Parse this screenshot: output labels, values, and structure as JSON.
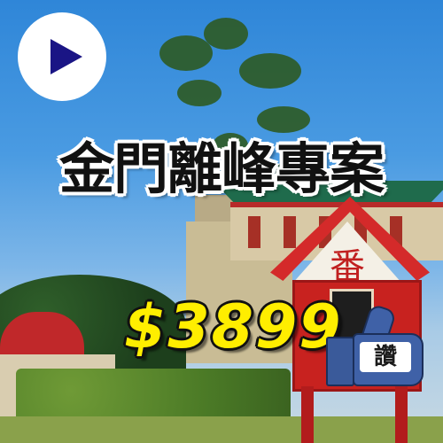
{
  "banner": {
    "title": "金門離峰專案",
    "price": "$3899",
    "like_label": "讚",
    "shrine_character": "番"
  },
  "controls": {
    "play_icon": "play-icon"
  },
  "colors": {
    "price_text": "#ffee00",
    "play_triangle": "#1a1585",
    "like_badge": "#3f61a7"
  }
}
